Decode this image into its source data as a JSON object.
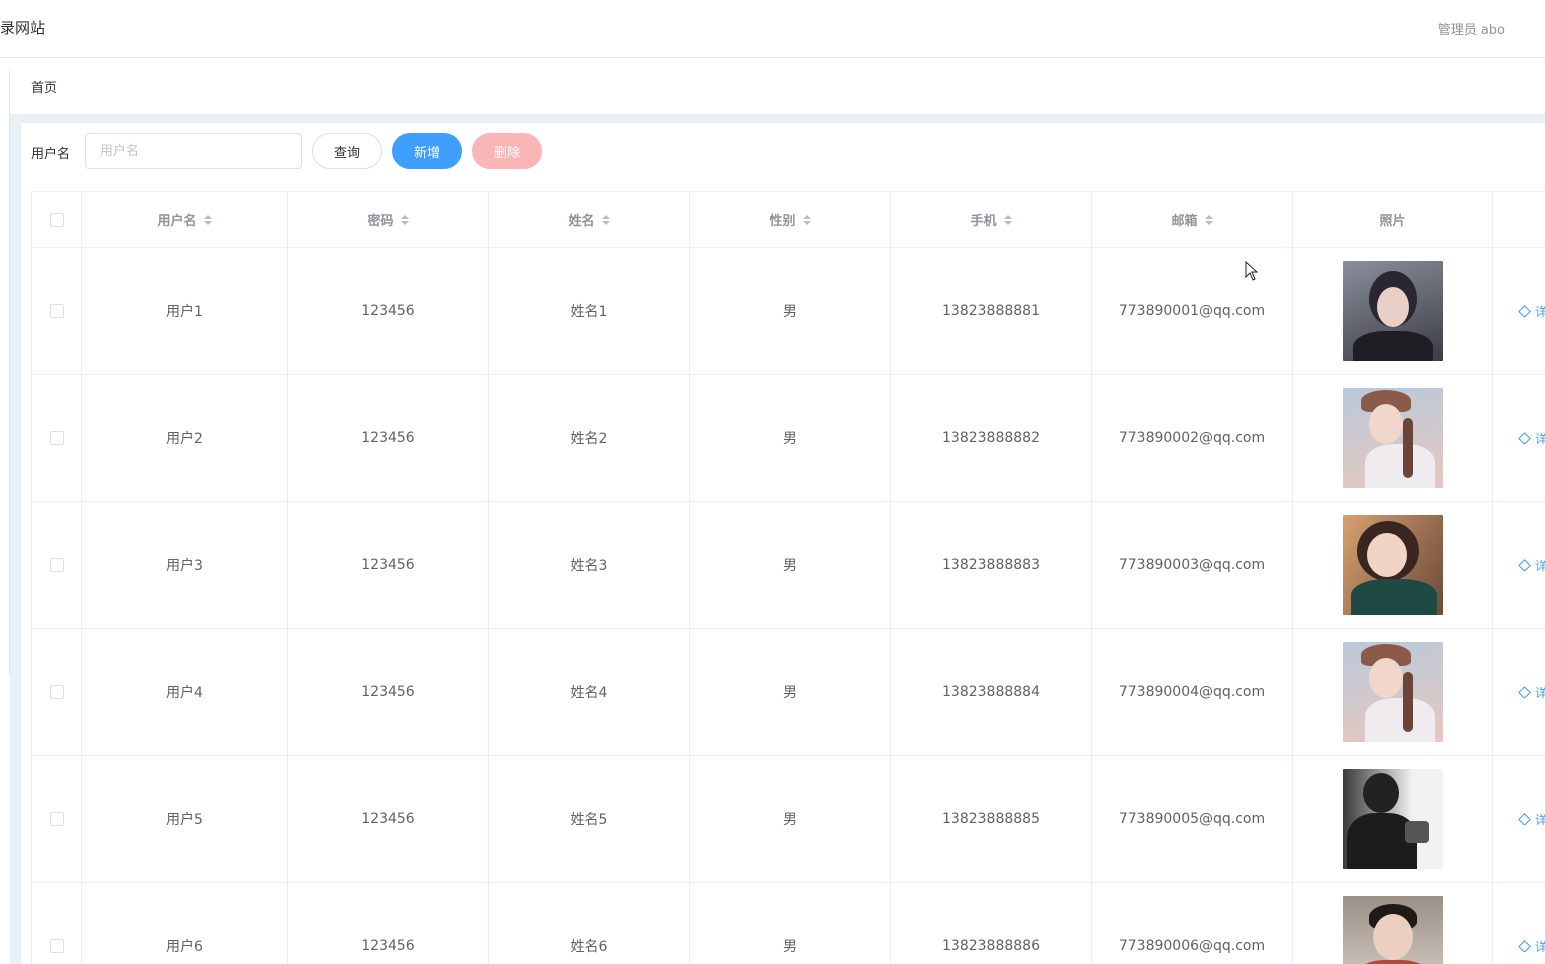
{
  "header": {
    "site_title": "录网站",
    "user_info": "管理员 abo"
  },
  "breadcrumb": {
    "home": "首页"
  },
  "filter": {
    "label": "用户名",
    "placeholder": "用户名",
    "value": "",
    "query_label": "查询",
    "add_label": "新增",
    "delete_label": "删除"
  },
  "colors": {
    "primary": "#409eff",
    "danger_disabled": "#fab6b6",
    "border": "#ebeef5"
  },
  "table": {
    "columns": [
      "用户名",
      "密码",
      "姓名",
      "性别",
      "手机",
      "邮箱",
      "照片"
    ],
    "edit_label": "详",
    "rows": [
      {
        "username": "用户1",
        "password": "123456",
        "name": "姓名1",
        "gender": "男",
        "phone": "13823888881",
        "email": "773890001@qq.com",
        "photo": "portrait-photo"
      },
      {
        "username": "用户2",
        "password": "123456",
        "name": "姓名2",
        "gender": "男",
        "phone": "13823888882",
        "email": "773890002@qq.com",
        "photo": "portrait-photo"
      },
      {
        "username": "用户3",
        "password": "123456",
        "name": "姓名3",
        "gender": "男",
        "phone": "13823888883",
        "email": "773890003@qq.com",
        "photo": "portrait-photo"
      },
      {
        "username": "用户4",
        "password": "123456",
        "name": "姓名4",
        "gender": "男",
        "phone": "13823888884",
        "email": "773890004@qq.com",
        "photo": "portrait-photo"
      },
      {
        "username": "用户5",
        "password": "123456",
        "name": "姓名5",
        "gender": "男",
        "phone": "13823888885",
        "email": "773890005@qq.com",
        "photo": "portrait-photo"
      },
      {
        "username": "用户6",
        "password": "123456",
        "name": "姓名6",
        "gender": "男",
        "phone": "13823888886",
        "email": "773890006@qq.com",
        "photo": "portrait-photo"
      }
    ]
  }
}
